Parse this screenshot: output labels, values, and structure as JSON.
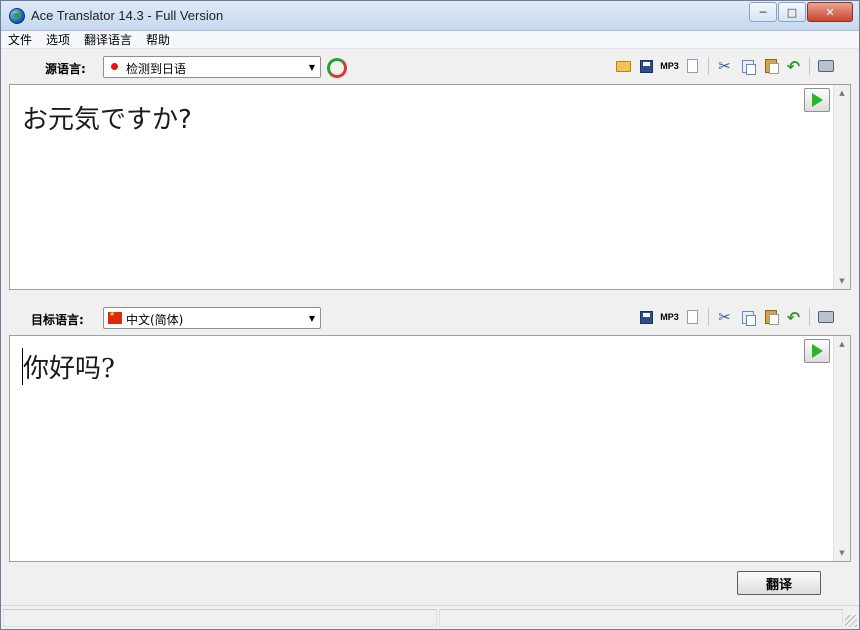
{
  "window": {
    "title": "Ace Translator 14.3 - Full Version",
    "controls": {
      "minimize": "─",
      "maximize": "□",
      "close": "✕"
    }
  },
  "menu": [
    "文件",
    "选项",
    "翻译语言",
    "帮助"
  ],
  "source": {
    "label": "源语言:",
    "language": "检测到日语",
    "flag": "jp-flag-icon",
    "text": "お元気ですか?"
  },
  "target": {
    "label": "目标语言:",
    "language": "中文(简体)",
    "flag": "cn-flag-icon",
    "text": "你好吗?"
  },
  "toolbar_icons": {
    "mp3": "MP3",
    "cut": "✂",
    "undo": "↶",
    "dropdown_arrow": "▼",
    "scroll_up": "▲",
    "scroll_down": "▼"
  },
  "actions": {
    "translate": "翻译"
  },
  "colors": {
    "play_green": "#28b528",
    "titlebar": "#dde9f7",
    "close_red": "#c9432d"
  }
}
